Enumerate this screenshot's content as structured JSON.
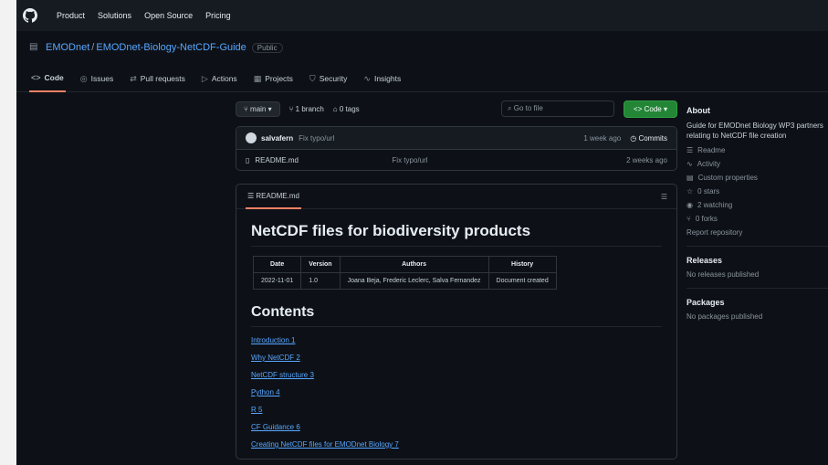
{
  "nav": {
    "items": [
      "Product",
      "Solutions",
      "Open Source",
      "Pricing"
    ]
  },
  "repo": {
    "owner": "EMODnet",
    "name": "EMODnet-Biology-NetCDF-Guide",
    "visibility": "Public"
  },
  "tabs": [
    {
      "label": "Code"
    },
    {
      "label": "Issues"
    },
    {
      "label": "Pull requests"
    },
    {
      "label": "Actions"
    },
    {
      "label": "Projects"
    },
    {
      "label": "Security"
    },
    {
      "label": "Insights"
    }
  ],
  "toolbar": {
    "branch": "main",
    "branches": "1 branch",
    "tags": "0 tags",
    "goto_placeholder": "Go to file",
    "code_button": "Code"
  },
  "commit": {
    "user": "salvafern",
    "message": "Fix typo/url",
    "meta": "1 week ago",
    "count": "Commits"
  },
  "files": [
    {
      "name": "README.md",
      "message": "Fix typo/url",
      "time": "2 weeks ago"
    }
  ],
  "readme": {
    "header": "README.md",
    "title": "NetCDF files for biodiversity products",
    "table": {
      "headers": [
        "Date",
        "Version",
        "Authors",
        "History"
      ],
      "rows": [
        [
          "2022-11-01",
          "1.0",
          "Joana Beja, Frederic Leclerc, Salva Fernandez",
          "Document created"
        ]
      ]
    },
    "contents_title": "Contents",
    "toc": [
      "Introduction 1",
      "Why NetCDF 2",
      "NetCDF structure 3",
      "Python 4",
      "R 5",
      "CF Guidance 6",
      "Creating NetCDF files for EMODnet Biology 7"
    ]
  },
  "sidebar": {
    "about_title": "About",
    "about_desc": "Guide for EMODnet Biology WP3 partners relating to NetCDF file creation",
    "items": [
      "Readme",
      "Activity",
      "Custom properties",
      "0 stars",
      "2 watching",
      "0 forks",
      "Report repository"
    ],
    "releases_title": "Releases",
    "releases_text": "No releases published",
    "packages_title": "Packages",
    "packages_text": "No packages published"
  }
}
